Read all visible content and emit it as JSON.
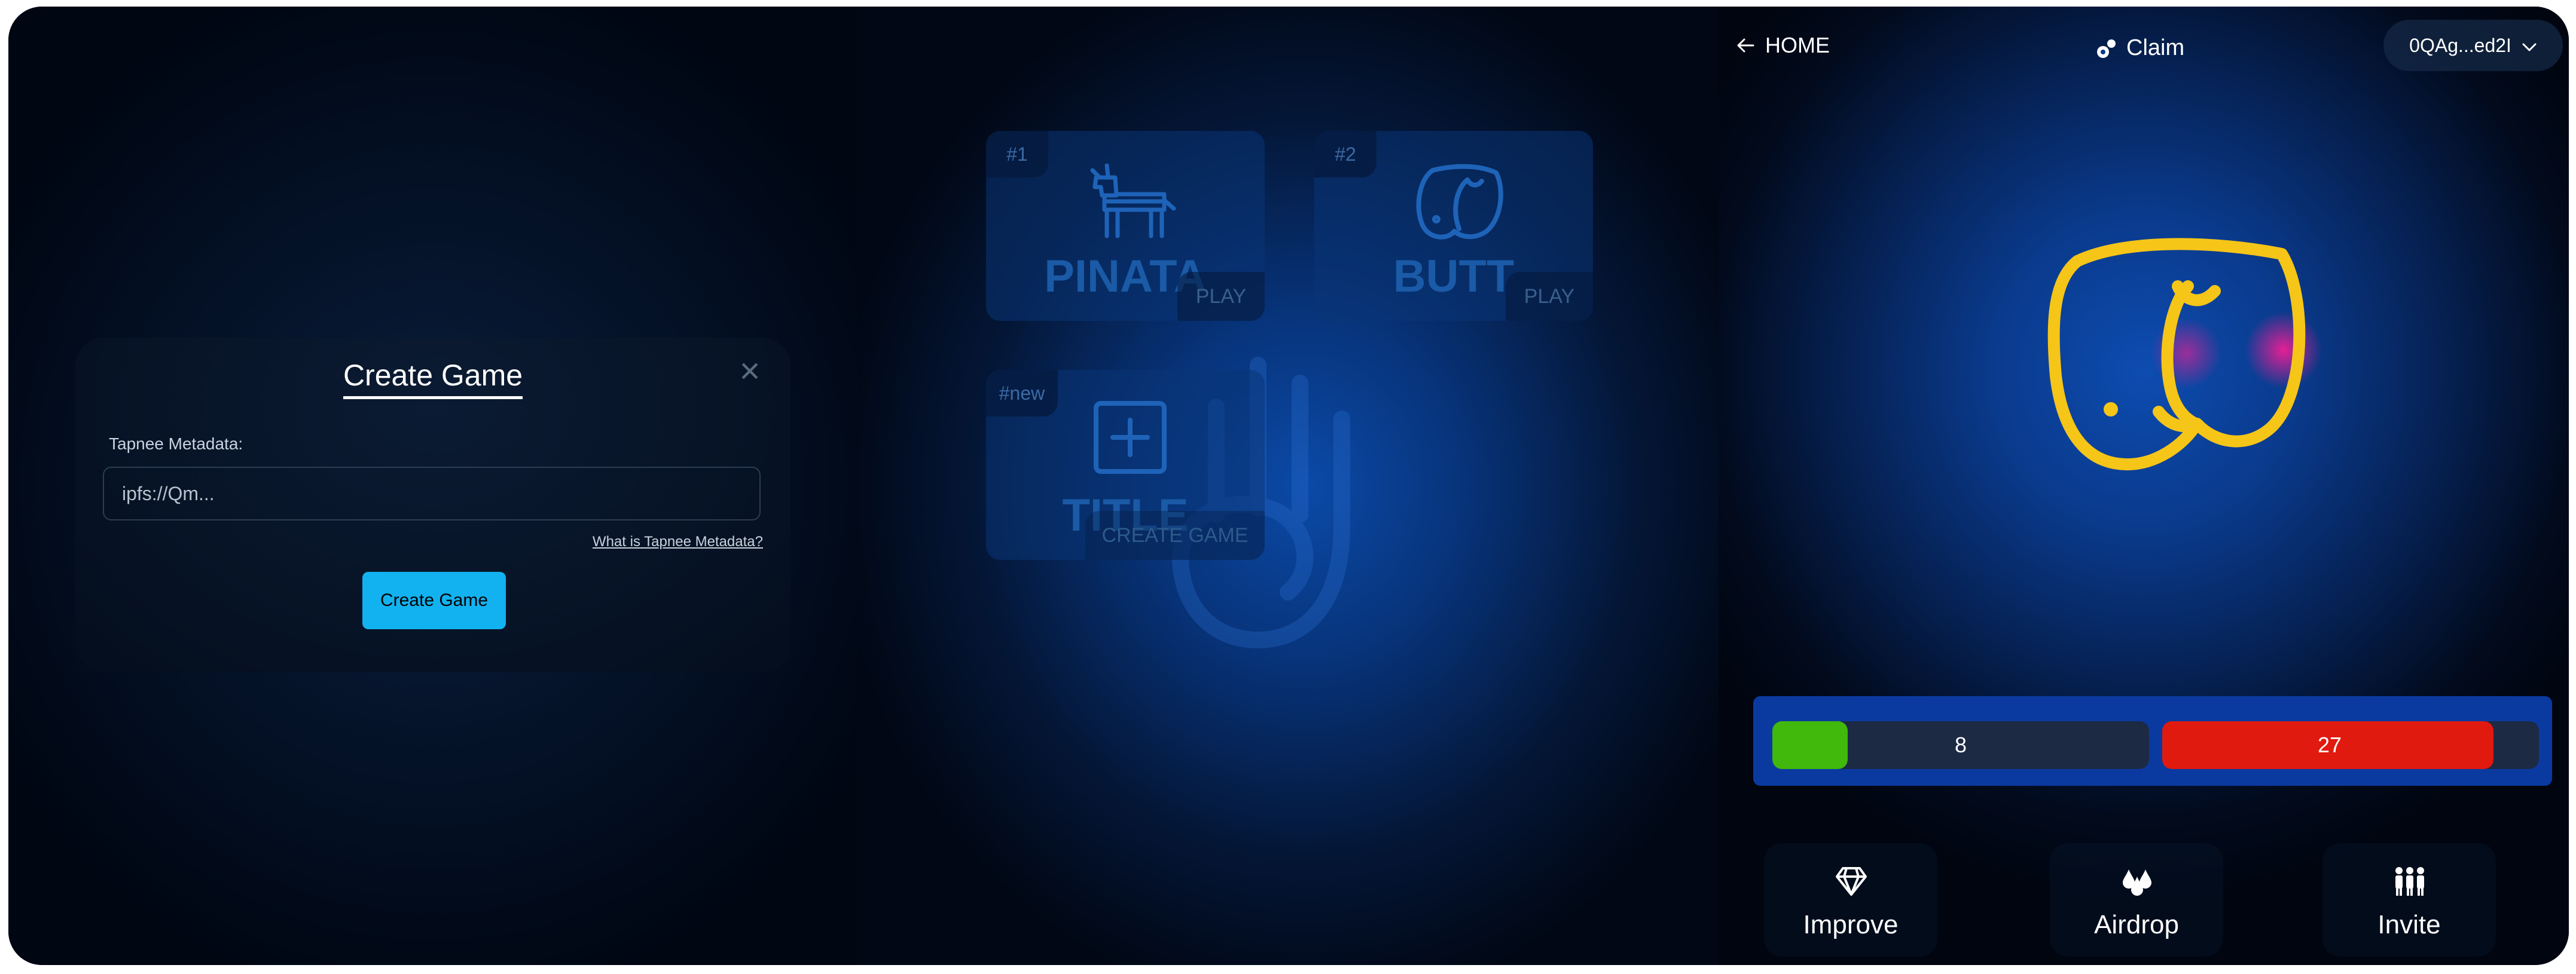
{
  "create_game_modal": {
    "title": "Create Game",
    "close_icon": "close-icon",
    "field_label": "Tapnee Metadata:",
    "field_placeholder": "ipfs://Qm...",
    "help_link": "What is Tapnee Metadata?",
    "submit_label": "Create Game",
    "submit_color": "#12b2f0"
  },
  "game_list": {
    "cards": [
      {
        "tag": "#1",
        "title": "PINATA",
        "action": "PLAY",
        "icon": "pinata-icon"
      },
      {
        "tag": "#2",
        "title": "BUTT",
        "action": "PLAY",
        "icon": "butt-icon"
      },
      {
        "tag": "#new",
        "title": "TITLE",
        "action": "CREATE GAME",
        "icon": "plus-box-icon"
      }
    ],
    "background_icon": "hand-icon"
  },
  "game": {
    "header": {
      "home_label": "HOME",
      "home_icon": "arrow-left-icon",
      "claim_label": "Claim",
      "claim_icon": "claim-icon",
      "wallet_label": "0QAg...ed2I",
      "wallet_icon": "chevron-down-icon"
    },
    "target_icon": "butt-icon",
    "target_color": "#f5c518",
    "score": {
      "left_value": "8",
      "left_fill": 0.2,
      "left_color": "#40b80c",
      "right_value": "27",
      "right_fill": 0.88,
      "right_color": "#e01a0e"
    },
    "nav": [
      {
        "label": "Improve",
        "icon": "diamond-icon"
      },
      {
        "label": "Airdrop",
        "icon": "drops-icon"
      },
      {
        "label": "Invite",
        "icon": "people-icon"
      }
    ]
  }
}
